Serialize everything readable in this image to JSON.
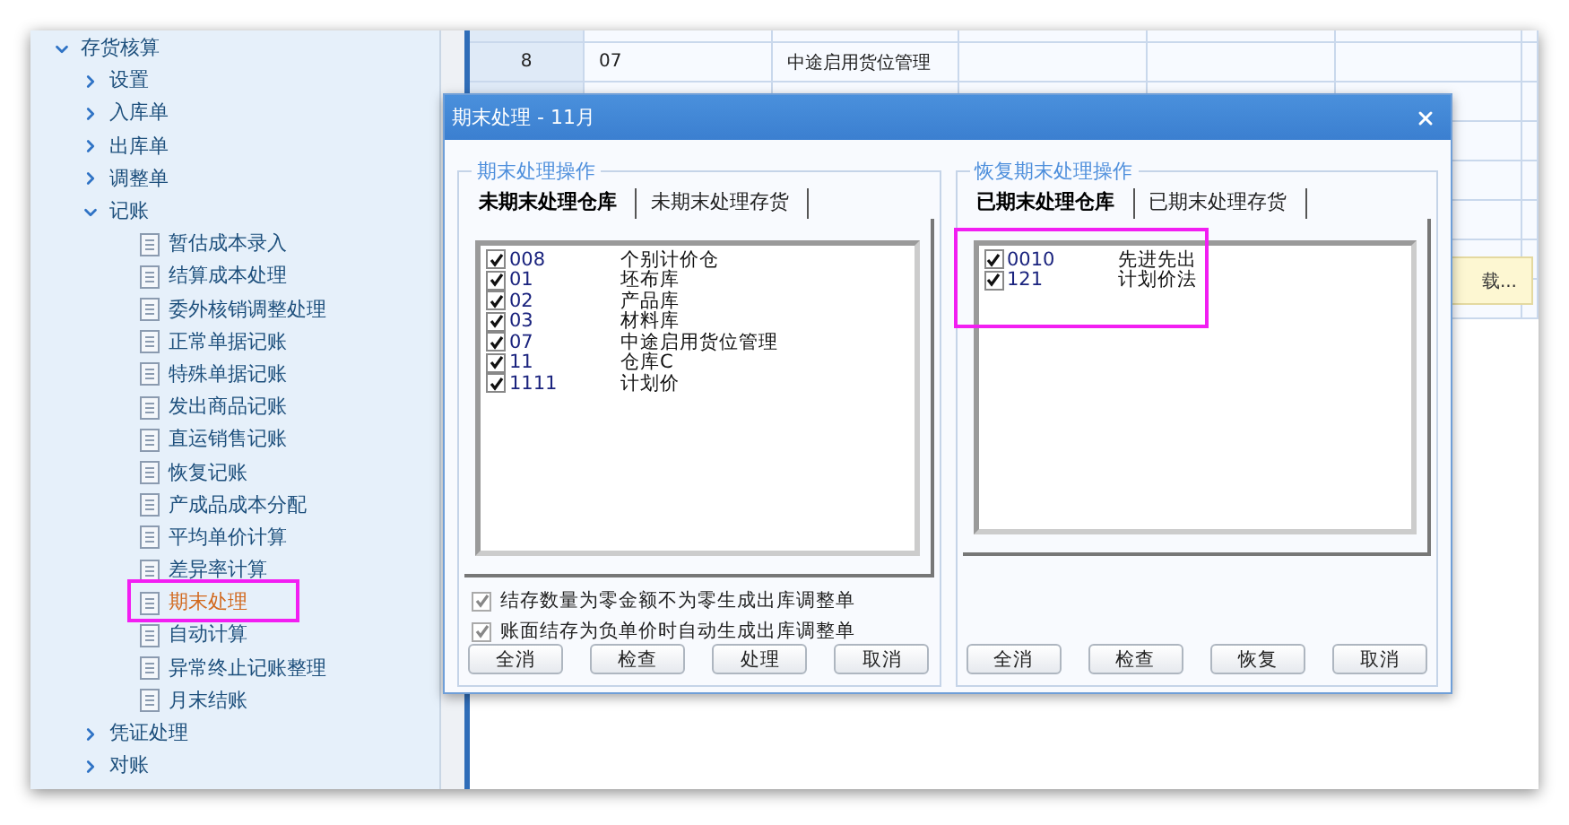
{
  "sidebar": {
    "tree": [
      {
        "label": "存货核算",
        "expanded": true,
        "selected": false,
        "children": [
          {
            "label": "设置",
            "expanded": false,
            "selected": false
          },
          {
            "label": "入库单",
            "expanded": false,
            "selected": false
          },
          {
            "label": "出库单",
            "expanded": false,
            "selected": false
          },
          {
            "label": "调整单",
            "expanded": false,
            "selected": false
          },
          {
            "label": "记账",
            "expanded": true,
            "selected": false,
            "children": [
              {
                "label": "暂估成本录入",
                "selected": false
              },
              {
                "label": "结算成本处理",
                "selected": false
              },
              {
                "label": "委外核销调整处理",
                "selected": false
              },
              {
                "label": "正常单据记账",
                "selected": false
              },
              {
                "label": "特殊单据记账",
                "selected": false
              },
              {
                "label": "发出商品记账",
                "selected": false
              },
              {
                "label": "直运销售记账",
                "selected": false
              },
              {
                "label": "恢复记账",
                "selected": false
              },
              {
                "label": "产成品成本分配",
                "selected": false
              },
              {
                "label": "平均单价计算",
                "selected": false
              },
              {
                "label": "差异率计算",
                "selected": false
              },
              {
                "label": "期末处理",
                "selected": true
              },
              {
                "label": "自动计算",
                "selected": false
              },
              {
                "label": "异常终止记账整理",
                "selected": false
              },
              {
                "label": "月末结账",
                "selected": false
              }
            ]
          },
          {
            "label": "凭证处理",
            "expanded": false,
            "selected": false
          },
          {
            "label": "对账",
            "expanded": false,
            "selected": false
          }
        ]
      }
    ]
  },
  "grid": {
    "rows": [
      {
        "cells": [
          "8",
          "07",
          "中途启用货位管理"
        ]
      }
    ]
  },
  "tooltip": {
    "text": "载..."
  },
  "dialog": {
    "title": "期末处理 - 11月",
    "panels": [
      {
        "title": "期末处理操作",
        "tabs": [
          {
            "label": "未期末处理仓库",
            "selected": true
          },
          {
            "label": "未期末处理存货",
            "selected": false
          }
        ],
        "items": [
          {
            "code": "008",
            "name": "个别计价仓",
            "checked": true
          },
          {
            "code": "01",
            "name": "坯布库",
            "checked": true
          },
          {
            "code": "02",
            "name": "产品库",
            "checked": true
          },
          {
            "code": "03",
            "name": "材料库",
            "checked": true
          },
          {
            "code": "07",
            "name": "中途启用货位管理",
            "checked": true
          },
          {
            "code": "11",
            "name": "仓库C",
            "checked": true
          },
          {
            "code": "1111",
            "name": "计划价",
            "checked": true
          }
        ],
        "options": [
          {
            "label": "结存数量为零金额不为零生成出库调整单",
            "checked": true
          },
          {
            "label": "账面结存为负单价时自动生成出库调整单",
            "checked": true
          }
        ],
        "buttons": [
          "全消",
          "检查",
          "处理",
          "取消"
        ]
      },
      {
        "title": "恢复期末处理操作",
        "highlighted": true,
        "tabs": [
          {
            "label": "已期末处理仓库",
            "selected": true
          },
          {
            "label": "已期末处理存货",
            "selected": false
          }
        ],
        "items": [
          {
            "code": "0010",
            "name": "先进先出",
            "checked": true
          },
          {
            "code": "121",
            "name": "计划价法",
            "checked": true
          }
        ],
        "buttons": [
          "全消",
          "检查",
          "恢复",
          "取消"
        ]
      }
    ]
  }
}
